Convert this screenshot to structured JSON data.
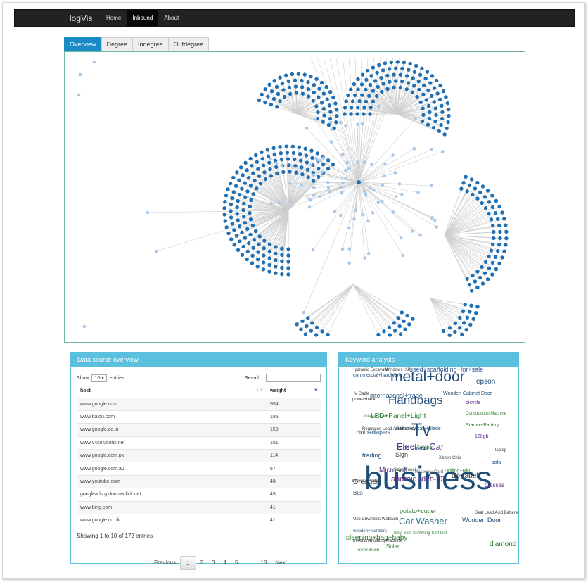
{
  "navbar": {
    "brand": "logVis",
    "items": [
      {
        "label": "Home",
        "active": false
      },
      {
        "label": "Inbound",
        "active": true
      },
      {
        "label": "About",
        "active": false
      }
    ]
  },
  "tabs": [
    {
      "label": "Overview",
      "active": true
    },
    {
      "label": "Degree",
      "active": false
    },
    {
      "label": "Indegree",
      "active": false
    },
    {
      "label": "Outdegree",
      "active": false
    }
  ],
  "graph": {
    "colors": {
      "light_node": "#a9c9ea",
      "dark_node": "#1f6fb2",
      "edge": "#cfcfcf",
      "border": "#6fb79d"
    }
  },
  "datasource": {
    "title": "Data source overview",
    "show_label": "Show",
    "show_value": "10",
    "entries_label": "entries",
    "search_label": "Search:",
    "search_value": "",
    "columns": [
      "host",
      "weight"
    ],
    "rows": [
      {
        "host": "www.google.com",
        "weight": "554"
      },
      {
        "host": "www.baidu.com",
        "weight": "185"
      },
      {
        "host": "www.google.co.in",
        "weight": "159"
      },
      {
        "host": "www.v4solutions.net",
        "weight": "151"
      },
      {
        "host": "www.google.com.pk",
        "weight": "114"
      },
      {
        "host": "www.google.com.au",
        "weight": "67"
      },
      {
        "host": "www.youtube.com",
        "weight": "48"
      },
      {
        "host": "googleads.g.doubleclick.net",
        "weight": "45"
      },
      {
        "host": "www.bing.com",
        "weight": "41"
      },
      {
        "host": "www.google.co.uk",
        "weight": "41"
      }
    ],
    "info": "Showing 1 to 10 of 172 entries",
    "pager": {
      "previous": "Previous",
      "pages": [
        "1",
        "2",
        "3",
        "4",
        "5",
        "…",
        "18"
      ],
      "next": "Next",
      "current": "1"
    }
  },
  "keywords": {
    "title": "Keyword analysis",
    "words": [
      {
        "text": "business",
        "color": "#1f4e79"
      },
      {
        "text": "metal+door",
        "color": "#1f4e79"
      },
      {
        "text": "Tv",
        "color": "#1f4e79"
      },
      {
        "text": "Handbags",
        "color": "#1f4e79"
      },
      {
        "text": "Electric Car",
        "color": "#5a2a82"
      },
      {
        "text": "Car Washer",
        "color": "#2a6f8a"
      },
      {
        "text": "epson",
        "color": "#1f4e79"
      },
      {
        "text": "international+trade",
        "color": "#1f4e79"
      },
      {
        "text": "used+scaffolding+for+sale",
        "color": "#3a5a9a"
      },
      {
        "text": "LED+Panel+Light",
        "color": "#2e7d32"
      },
      {
        "text": "android+dvb-s2",
        "color": "#5a2a82"
      },
      {
        "text": "dk+label",
        "color": "#333333"
      },
      {
        "text": "sleeping+bag+baby",
        "color": "#2e7d32"
      },
      {
        "text": "potato+cutter",
        "color": "#2e7d32"
      },
      {
        "text": "Microsoft",
        "color": "#5a2a82"
      },
      {
        "text": "Dredger",
        "color": "#333333"
      },
      {
        "text": "Wooden Door",
        "color": "#1f4e79"
      },
      {
        "text": "Wooden Cabinet Door",
        "color": "#1f4e79"
      },
      {
        "text": "diamond",
        "color": "#2e7d32"
      },
      {
        "text": "trading",
        "color": "#1f4e79"
      },
      {
        "text": "commercial+hardware",
        "color": "#1f4e79"
      },
      {
        "text": "bicycle",
        "color": "#5a2a82"
      },
      {
        "text": "diamond+saw+blade",
        "color": "#1f4e79"
      },
      {
        "text": "cloth+diapers",
        "color": "#1f4e79"
      },
      {
        "text": "Drilling+Rig",
        "color": "#2e7d32"
      },
      {
        "text": "dresses",
        "color": "#5a2a82"
      },
      {
        "text": "Sign",
        "color": "#333333"
      },
      {
        "text": "Bus",
        "color": "#1f4e79"
      },
      {
        "text": "Solar",
        "color": "#2e7d32"
      },
      {
        "text": "sofa",
        "color": "#1f4e79"
      },
      {
        "text": "Starter+Battery",
        "color": "#2e7d32"
      },
      {
        "text": "128gb",
        "color": "#5a2a82"
      },
      {
        "text": "Construction Machine",
        "color": "#2e7d32"
      },
      {
        "text": "Recovery Card",
        "color": "#555555"
      },
      {
        "text": "Bicycle+Parts",
        "color": "#333333"
      },
      {
        "text": "wooden+numbers",
        "color": "#1f4e79"
      },
      {
        "text": "Best Slim Slimming Soft Gel",
        "color": "#2e7d32"
      },
      {
        "text": "Hydraulic Excavator",
        "color": "#333333"
      },
      {
        "text": "Windows+XP",
        "color": "#333333"
      },
      {
        "text": "V Cable",
        "color": "#333333"
      },
      {
        "text": "power+bank",
        "color": "#333333"
      },
      {
        "text": "Glass+Plate",
        "color": "#2e7d32"
      },
      {
        "text": "Regulated Lead Acid Battery",
        "color": "#333333"
      },
      {
        "text": "labtop",
        "color": "#333333"
      },
      {
        "text": "Toxin+Brush",
        "color": "#2e7d32"
      },
      {
        "text": "Leather",
        "color": "#2e7d32"
      },
      {
        "text": "P3SS Flowers",
        "color": "#1f4e79"
      },
      {
        "text": "Solar Panel",
        "color": "#2e7d32"
      },
      {
        "text": "Xenon Chip",
        "color": "#333333"
      },
      {
        "text": "Injection Molding Machine",
        "color": "#333333"
      },
      {
        "text": "Usb Driverless Webcam",
        "color": "#333333"
      },
      {
        "text": "Seal Lead Acid Batteries",
        "color": "#333333"
      }
    ]
  }
}
